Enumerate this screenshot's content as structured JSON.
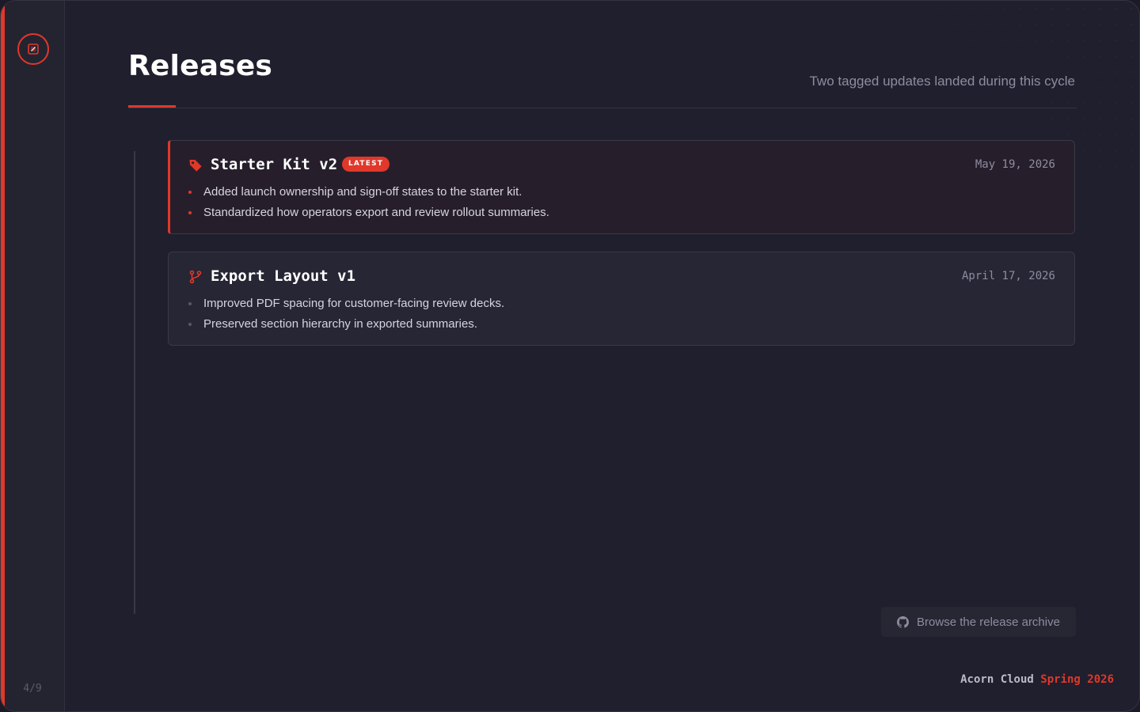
{
  "sidebar": {
    "page_counter": "4/9"
  },
  "header": {
    "title": "Releases",
    "subtitle": "Two tagged updates landed during this cycle"
  },
  "releases": [
    {
      "title": "Starter Kit v2",
      "badge": "LATEST",
      "date": "May 19, 2026",
      "icon": "tag-icon",
      "notes": [
        "Added launch ownership and sign-off states to the starter kit.",
        "Standardized how operators export and review rollout summaries."
      ]
    },
    {
      "title": "Export Layout v1",
      "date": "April 17, 2026",
      "icon": "git-branch-icon",
      "notes": [
        "Improved PDF spacing for customer-facing review decks.",
        "Preserved section hierarchy in exported summaries."
      ]
    }
  ],
  "archive_button": {
    "label": "Browse the release archive",
    "icon": "github-icon"
  },
  "footer": {
    "brand": "Acorn Cloud",
    "season": "Spring 2026"
  },
  "colors": {
    "accent": "#e0382a",
    "background": "#201f2d",
    "sidebar": "#242431",
    "card": "#262634"
  }
}
